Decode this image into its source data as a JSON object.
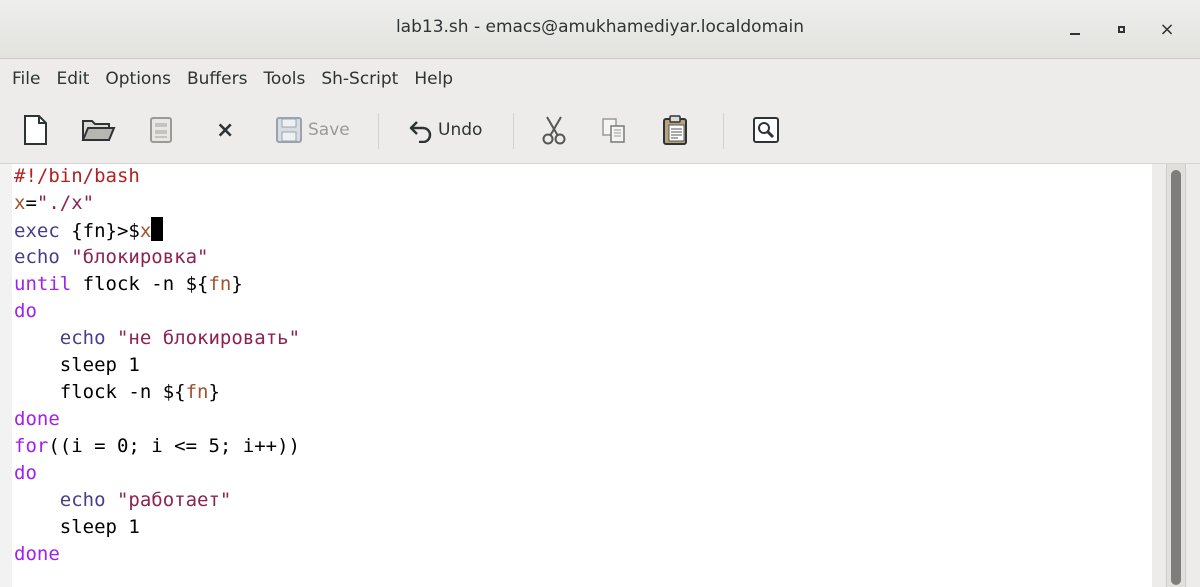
{
  "window": {
    "title": "lab13.sh - emacs@amukhamediyar.localdomain",
    "minimize_icon": "minimize-icon",
    "maximize_icon": "maximize-icon",
    "close_label": "×"
  },
  "menu": {
    "items": [
      "File",
      "Edit",
      "Options",
      "Buffers",
      "Tools",
      "Sh-Script",
      "Help"
    ]
  },
  "toolbar": {
    "save_label": "Save",
    "undo_label": "Undo",
    "close_glyph": "×",
    "icons": [
      "new-file-icon",
      "open-folder-icon",
      "dired-icon",
      "close-buffer-icon",
      "save-icon",
      "undo-icon",
      "cut-icon",
      "copy-icon",
      "paste-icon",
      "search-icon"
    ]
  },
  "editor": {
    "lines": [
      [
        {
          "t": "#!/bin/bash",
          "c": "comment"
        }
      ],
      [
        {
          "t": "x",
          "c": "var"
        },
        {
          "t": "=",
          "c": ""
        },
        {
          "t": "\"./x\"",
          "c": "str"
        }
      ],
      [
        {
          "t": "exec",
          "c": "builtin"
        },
        {
          "t": " {fn}>$",
          "c": ""
        },
        {
          "t": "x",
          "c": "var"
        },
        {
          "t": "",
          "c": "cursor"
        }
      ],
      [
        {
          "t": "echo",
          "c": "builtin"
        },
        {
          "t": " ",
          "c": ""
        },
        {
          "t": "\"блокировка\"",
          "c": "str"
        }
      ],
      [
        {
          "t": "until",
          "c": "kw"
        },
        {
          "t": " flock -n ${",
          "c": ""
        },
        {
          "t": "fn",
          "c": "var"
        },
        {
          "t": "}",
          "c": ""
        }
      ],
      [
        {
          "t": "do",
          "c": "kw"
        }
      ],
      [
        {
          "t": "    ",
          "c": ""
        },
        {
          "t": "echo",
          "c": "builtin"
        },
        {
          "t": " ",
          "c": ""
        },
        {
          "t": "\"не блокировать\"",
          "c": "str"
        }
      ],
      [
        {
          "t": "    sleep 1",
          "c": ""
        }
      ],
      [
        {
          "t": "    flock -n ${",
          "c": ""
        },
        {
          "t": "fn",
          "c": "var"
        },
        {
          "t": "}",
          "c": ""
        }
      ],
      [
        {
          "t": "done",
          "c": "kw"
        }
      ],
      [
        {
          "t": "for",
          "c": "kw"
        },
        {
          "t": "((i = 0; i <= 5; i++))",
          "c": ""
        }
      ],
      [
        {
          "t": "do",
          "c": "kw"
        }
      ],
      [
        {
          "t": "    ",
          "c": ""
        },
        {
          "t": "echo",
          "c": "builtin"
        },
        {
          "t": " ",
          "c": ""
        },
        {
          "t": "\"работает\"",
          "c": "str"
        }
      ],
      [
        {
          "t": "    sleep 1",
          "c": ""
        }
      ],
      [
        {
          "t": "done",
          "c": "kw"
        }
      ]
    ]
  },
  "colors": {
    "comment": "#b22222",
    "variable": "#a0522d",
    "string": "#8b2252",
    "keyword": "#a020f0",
    "builtin": "#483d8b"
  }
}
